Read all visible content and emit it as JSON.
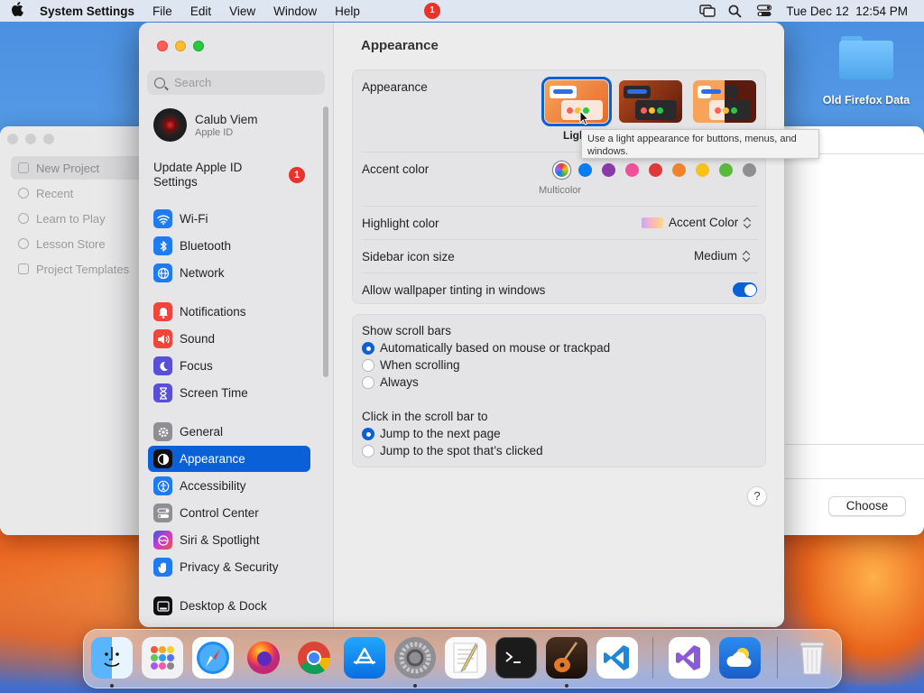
{
  "menubar": {
    "app_name": "System Settings",
    "menus": [
      "File",
      "Edit",
      "View",
      "Window",
      "Help"
    ],
    "datetime": "Tue Dec 12  12:54 PM",
    "right_icons": [
      "screen-mirroring-icon",
      "spotlight-search-icon",
      "control-center-icon"
    ]
  },
  "desktop": {
    "folder_label": "Old Firefox Data"
  },
  "background_window": {
    "sidebar": [
      "New Project",
      "Recent",
      "Learn to Play",
      "Lesson Store",
      "Project Templates"
    ],
    "choose_label": "Choose"
  },
  "settings": {
    "search_placeholder": "Search",
    "account": {
      "name": "Calub Viem",
      "subtitle": "Apple ID"
    },
    "update_label": "Update Apple ID Settings",
    "update_badge": "1",
    "nav": [
      {
        "label": "Wi-Fi",
        "icon": "wifi-icon",
        "color": "#1e7bf2"
      },
      {
        "label": "Bluetooth",
        "icon": "bluetooth-icon",
        "color": "#1e7bf2"
      },
      {
        "label": "Network",
        "icon": "globe-icon",
        "color": "#1e7bf2"
      },
      {
        "label": "Notifications",
        "icon": "bell-icon",
        "color": "#f0453a"
      },
      {
        "label": "Sound",
        "icon": "speaker-icon",
        "color": "#f0453a"
      },
      {
        "label": "Focus",
        "icon": "moon-icon",
        "color": "#5a4fd8"
      },
      {
        "label": "Screen Time",
        "icon": "hourglass-icon",
        "color": "#5a4fd8"
      },
      {
        "label": "General",
        "icon": "gear-icon",
        "color": "#8e8e93"
      },
      {
        "label": "Appearance",
        "icon": "appearance-icon",
        "color": "#111111"
      },
      {
        "label": "Accessibility",
        "icon": "accessibility-icon",
        "color": "#1e7bf2"
      },
      {
        "label": "Control Center",
        "icon": "toggles-icon",
        "color": "#8e8e93"
      },
      {
        "label": "Siri & Spotlight",
        "icon": "siri-icon",
        "color": "#a047d6"
      },
      {
        "label": "Privacy & Security",
        "icon": "hand-icon",
        "color": "#1e7bf2"
      },
      {
        "label": "Desktop & Dock",
        "icon": "dock-icon",
        "color": "#111111"
      }
    ],
    "selected_nav": "Appearance"
  },
  "pane": {
    "title": "Appearance",
    "appearance_label": "Appearance",
    "appearance_options": [
      "Light",
      "Dark",
      "Auto"
    ],
    "appearance_selected": "Light",
    "appearance_selected_visible_label": "Ligh",
    "tooltip": "Use a light appearance for buttons, menus, and windows.",
    "accent_label": "Accent color",
    "accent_colors": [
      "#a060ff",
      "#0a7cf2",
      "#8a3aa8",
      "#f0509a",
      "#e0383a",
      "#f0832a",
      "#f5c21a",
      "#5ab83c",
      "#8e8e93"
    ],
    "accent_selected_caption": "Multicolor",
    "highlight_label": "Highlight color",
    "highlight_value": "Accent Color",
    "sidebar_icon_label": "Sidebar icon size",
    "sidebar_icon_value": "Medium",
    "tinting_label": "Allow wallpaper tinting in windows",
    "tinting_on": true,
    "scroll_title": "Show scroll bars",
    "scroll_options": [
      "Automatically based on mouse or trackpad",
      "When scrolling",
      "Always"
    ],
    "scroll_selected": 0,
    "click_title": "Click in the scroll bar to",
    "click_options": [
      "Jump to the next page",
      "Jump to the spot that’s clicked"
    ],
    "click_selected": 0,
    "help_label": "?"
  },
  "dock": {
    "badge": "1",
    "items": [
      "finder-icon",
      "launchpad-icon",
      "safari-icon",
      "firefox-icon",
      "chrome-icon",
      "app-store-icon",
      "system-settings-icon",
      "textedit-icon",
      "terminal-icon",
      "garageband-icon",
      "vscode-icon",
      "visual-studio-icon",
      "weather-icon",
      "trash-icon"
    ]
  }
}
